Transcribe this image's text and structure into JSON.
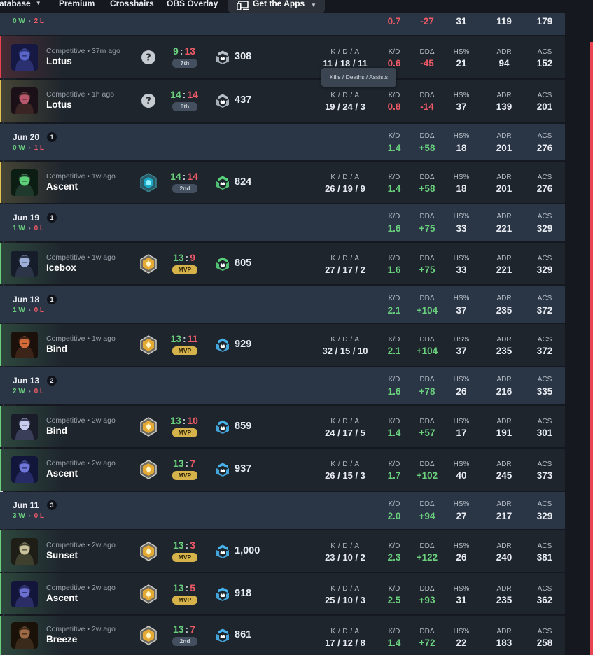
{
  "nav": {
    "items": [
      {
        "label": "atabase",
        "has_dropdown": true
      },
      {
        "label": "Premium",
        "has_dropdown": false
      },
      {
        "label": "Crosshairs",
        "has_dropdown": false
      },
      {
        "label": "OBS Overlay",
        "has_dropdown": false
      }
    ],
    "apps_label": "Get the Apps",
    "apps_icon": "devices-icon"
  },
  "columns": {
    "kda": "K / D / A",
    "kd": "K/D",
    "dd": "DDΔ",
    "hs": "HS%",
    "adr": "ADR",
    "acs": "ACS"
  },
  "tooltip": "Kills / Deaths / Assists",
  "top_partial": {
    "wins": "0 W",
    "losses": "2 L",
    "kd": "0.7",
    "dd": "-27",
    "hs": "31",
    "adr": "119",
    "acs": "179"
  },
  "matches_jun21": [
    {
      "mode": "Competitive • 37m ago",
      "map": "Lotus",
      "agent_icon": "agent-portrait-icon",
      "rank_icon": "unrated-question-icon",
      "score_won": "9",
      "score_lost": "13",
      "result": "loss",
      "placement": "7th",
      "rr": "308",
      "rr_icon": "rank-silver-icon",
      "kda": "11 / 18 / 11",
      "kd": "0.6",
      "dd": "-45",
      "hs": "21",
      "adr": "94",
      "acs": "152",
      "accent": "#e8434f"
    },
    {
      "mode": "Competitive • 1h ago",
      "map": "Lotus",
      "agent_icon": "agent-portrait-icon",
      "rank_icon": "unrated-question-icon",
      "score_won": "14",
      "score_lost": "14",
      "result": "draw",
      "placement": "6th",
      "rr": "437",
      "rr_icon": "rank-silver-icon",
      "kda": "19 / 24 / 3",
      "kd": "0.8",
      "dd": "-14",
      "hs": "37",
      "adr": "139",
      "acs": "201",
      "accent": "#e2c253"
    }
  ],
  "days": [
    {
      "date": "Jun 20",
      "count": "1",
      "wins": "0 W",
      "losses": "1 L",
      "kd": "1.4",
      "dd": "+58",
      "hs": "18",
      "adr": "201",
      "acs": "276",
      "matches": [
        {
          "mode": "Competitive • 1w ago",
          "map": "Ascent",
          "agent_icon": "agent-portrait-icon",
          "rank_icon": "rank-diamond-icon",
          "score_won": "14",
          "score_lost": "14",
          "result": "draw",
          "placement": "2nd",
          "rr": "824",
          "rr_icon": "rank-green-icon",
          "kda": "26 / 19 / 9",
          "kd": "1.4",
          "dd": "+58",
          "hs": "18",
          "adr": "201",
          "acs": "276",
          "accent": "#e2c253"
        }
      ]
    },
    {
      "date": "Jun 19",
      "count": "1",
      "wins": "1 W",
      "losses": "0 L",
      "kd": "1.6",
      "dd": "+75",
      "hs": "33",
      "adr": "221",
      "acs": "329",
      "matches": [
        {
          "mode": "Competitive • 1w ago",
          "map": "Icebox",
          "agent_icon": "agent-portrait-icon",
          "rank_icon": "rank-gold-icon",
          "score_won": "13",
          "score_lost": "9",
          "result": "win",
          "placement": "MVP",
          "rr": "805",
          "rr_icon": "rank-green-icon",
          "kda": "27 / 17 / 2",
          "kd": "1.6",
          "dd": "+75",
          "hs": "33",
          "adr": "221",
          "acs": "329",
          "accent": "#6ad07d"
        }
      ]
    },
    {
      "date": "Jun 18",
      "count": "1",
      "wins": "1 W",
      "losses": "0 L",
      "kd": "2.1",
      "dd": "+104",
      "hs": "37",
      "adr": "235",
      "acs": "372",
      "matches": [
        {
          "mode": "Competitive • 1w ago",
          "map": "Bind",
          "agent_icon": "agent-portrait-icon",
          "rank_icon": "rank-gold-icon",
          "score_won": "13",
          "score_lost": "11",
          "result": "win",
          "placement": "MVP",
          "rr": "929",
          "rr_icon": "rank-blue-icon",
          "kda": "32 / 15 / 10",
          "kd": "2.1",
          "dd": "+104",
          "hs": "37",
          "adr": "235",
          "acs": "372",
          "accent": "#6ad07d"
        }
      ]
    },
    {
      "date": "Jun 13",
      "count": "2",
      "wins": "2 W",
      "losses": "0 L",
      "kd": "1.6",
      "dd": "+78",
      "hs": "26",
      "adr": "216",
      "acs": "335",
      "matches": [
        {
          "mode": "Competitive • 2w ago",
          "map": "Bind",
          "agent_icon": "agent-portrait-icon",
          "rank_icon": "rank-gold-icon",
          "score_won": "13",
          "score_lost": "10",
          "result": "win",
          "placement": "MVP",
          "rr": "859",
          "rr_icon": "rank-blue-icon",
          "kda": "24 / 17 / 5",
          "kd": "1.4",
          "dd": "+57",
          "hs": "17",
          "adr": "191",
          "acs": "301",
          "accent": "#6ad07d"
        },
        {
          "mode": "Competitive • 2w ago",
          "map": "Ascent",
          "agent_icon": "agent-portrait-icon",
          "rank_icon": "rank-gold-icon",
          "score_won": "13",
          "score_lost": "7",
          "result": "win",
          "placement": "MVP",
          "rr": "937",
          "rr_icon": "rank-blue-icon",
          "kda": "26 / 15 / 3",
          "kd": "1.7",
          "dd": "+102",
          "hs": "40",
          "adr": "245",
          "acs": "373",
          "accent": "#6ad07d"
        }
      ]
    },
    {
      "date": "Jun 11",
      "count": "3",
      "wins": "3 W",
      "losses": "0 L",
      "kd": "2.0",
      "dd": "+94",
      "hs": "27",
      "adr": "217",
      "acs": "329",
      "matches": [
        {
          "mode": "Competitive • 2w ago",
          "map": "Sunset",
          "agent_icon": "agent-portrait-icon",
          "rank_icon": "rank-gold-icon",
          "score_won": "13",
          "score_lost": "3",
          "result": "win",
          "placement": "MVP",
          "rr": "1,000",
          "rr_icon": "rank-blue-icon",
          "kda": "23 / 10 / 2",
          "kd": "2.3",
          "dd": "+122",
          "hs": "26",
          "adr": "240",
          "acs": "381",
          "accent": "#6ad07d"
        },
        {
          "mode": "Competitive • 2w ago",
          "map": "Ascent",
          "agent_icon": "agent-portrait-icon",
          "rank_icon": "rank-gold-icon",
          "score_won": "13",
          "score_lost": "5",
          "result": "win",
          "placement": "MVP",
          "rr": "918",
          "rr_icon": "rank-blue-icon",
          "kda": "25 / 10 / 3",
          "kd": "2.5",
          "dd": "+93",
          "hs": "31",
          "adr": "235",
          "acs": "362",
          "accent": "#6ad07d"
        },
        {
          "mode": "Competitive • 2w ago",
          "map": "Breeze",
          "agent_icon": "agent-portrait-icon",
          "rank_icon": "rank-gold-icon",
          "score_won": "13",
          "score_lost": "7",
          "result": "win",
          "placement": "2nd",
          "rr": "861",
          "rr_icon": "rank-blue-icon",
          "kda": "17 / 12 / 8",
          "kd": "1.4",
          "dd": "+72",
          "hs": "22",
          "adr": "183",
          "acs": "258",
          "accent": "#6ad07d"
        }
      ]
    }
  ]
}
